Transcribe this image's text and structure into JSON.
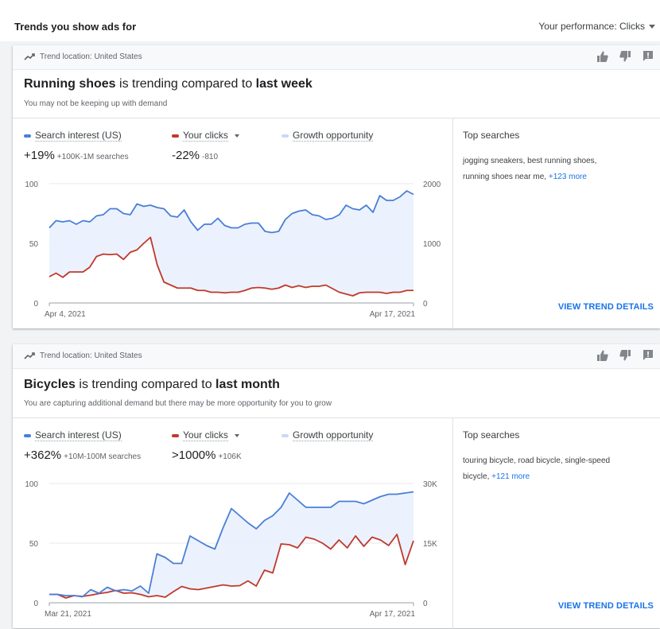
{
  "page": {
    "title": "Trends you show ads for",
    "performance_label": "Your performance: Clicks"
  },
  "colors": {
    "search": "#4a7fd6",
    "clicks": "#c0392b",
    "opportunity": "#e8f0fe"
  },
  "cards": [
    {
      "location": "Trend location: United States",
      "headline_subject": "Running shoes",
      "headline_mid": " is trending compared to ",
      "headline_period": "last week",
      "subtitle": "You may not be keeping up with demand",
      "legend": {
        "search": "Search interest (US)",
        "clicks": "Your clicks",
        "opportunity": "Growth opportunity"
      },
      "search_value": "+19%",
      "search_detail": "+100K-1M searches",
      "clicks_value": "-22%",
      "clicks_detail": "-810",
      "side_title": "Top searches",
      "side_text": "jogging sneakers, best running shoes, running shoes near me,",
      "side_more": "+123 more",
      "view_label": "VIEW TREND DETAILS",
      "chart_data": {
        "type": "line",
        "x_start_label": "Apr 4, 2021",
        "x_end_label": "Apr 17, 2021",
        "left_axis": {
          "ticks": [
            "100",
            "50",
            "0"
          ],
          "ylim": [
            0,
            100
          ]
        },
        "right_axis": {
          "ticks": [
            "2000",
            "1000",
            "0"
          ],
          "ylim": [
            0,
            2000
          ]
        },
        "series": [
          {
            "name": "Search interest (US)",
            "axis": "left",
            "values": [
              63,
              69,
              68,
              69,
              66,
              69,
              68,
              73,
              74,
              79,
              79,
              75,
              74,
              83,
              81,
              82,
              80,
              79,
              73,
              72,
              78,
              68,
              61,
              66,
              66,
              71,
              65,
              63,
              63,
              66,
              67,
              67,
              60,
              59,
              60,
              70,
              75,
              77,
              78,
              74,
              73,
              70,
              71,
              74,
              82,
              79,
              78,
              82,
              76,
              90,
              86,
              86,
              89,
              94,
              91
            ]
          },
          {
            "name": "Your clicks",
            "axis": "right",
            "values": [
              440,
              500,
              430,
              520,
              520,
              520,
              600,
              780,
              820,
              810,
              820,
              730,
              850,
              890,
              1000,
              1100,
              640,
              350,
              300,
              250,
              250,
              250,
              210,
              210,
              180,
              180,
              170,
              180,
              180,
              210,
              250,
              260,
              250,
              230,
              250,
              300,
              260,
              290,
              260,
              280,
              280,
              300,
              240,
              180,
              150,
              120,
              170,
              180,
              180,
              180,
              160,
              180,
              180,
              210,
              210
            ]
          }
        ]
      }
    },
    {
      "location": "Trend location: United States",
      "headline_subject": "Bicycles",
      "headline_mid": " is trending compared to ",
      "headline_period": "last month",
      "subtitle": "You are capturing additional demand but there may be more opportunity for you to grow",
      "legend": {
        "search": "Search interest (US)",
        "clicks": "Your clicks",
        "opportunity": "Growth opportunity"
      },
      "search_value": "+362%",
      "search_detail": "+10M-100M searches",
      "clicks_value": ">1000%",
      "clicks_detail": "+106K",
      "side_title": "Top searches",
      "side_text": "touring bicycle, road bicycle, single-speed bicycle,",
      "side_more": "+121 more",
      "view_label": "VIEW TREND DETAILS",
      "chart_data": {
        "type": "line",
        "x_start_label": "Mar 21, 2021",
        "x_end_label": "Apr 17, 2021",
        "left_axis": {
          "ticks": [
            "100",
            "50",
            "0"
          ],
          "ylim": [
            0,
            100
          ]
        },
        "right_axis": {
          "ticks": [
            "30K",
            "15K",
            "0"
          ],
          "ylim": [
            0,
            30000
          ]
        },
        "series": [
          {
            "name": "Search interest (US)",
            "axis": "left",
            "values": [
              7,
              7,
              6,
              6,
              5,
              11,
              8,
              13,
              10,
              11,
              10,
              14,
              8,
              41,
              38,
              33,
              33,
              56,
              52,
              48,
              45,
              63,
              79,
              73,
              67,
              62,
              69,
              73,
              80,
              92,
              86,
              80,
              80,
              80,
              80,
              85,
              85,
              85,
              83,
              86,
              89,
              91,
              91,
              92,
              93
            ]
          },
          {
            "name": "Your clicks",
            "axis": "right",
            "values": [
              2100,
              2100,
              1200,
              1800,
              1600,
              1900,
              2300,
              2600,
              3100,
              2400,
              2500,
              2100,
              1500,
              1800,
              1400,
              2800,
              4100,
              3500,
              3300,
              3700,
              4100,
              4500,
              4200,
              4300,
              5500,
              4200,
              8200,
              7500,
              14800,
              14600,
              13800,
              16500,
              16000,
              15000,
              13500,
              15800,
              13800,
              16800,
              14200,
              16500,
              15800,
              14400,
              17200,
              9600,
              15600
            ]
          }
        ]
      }
    }
  ]
}
